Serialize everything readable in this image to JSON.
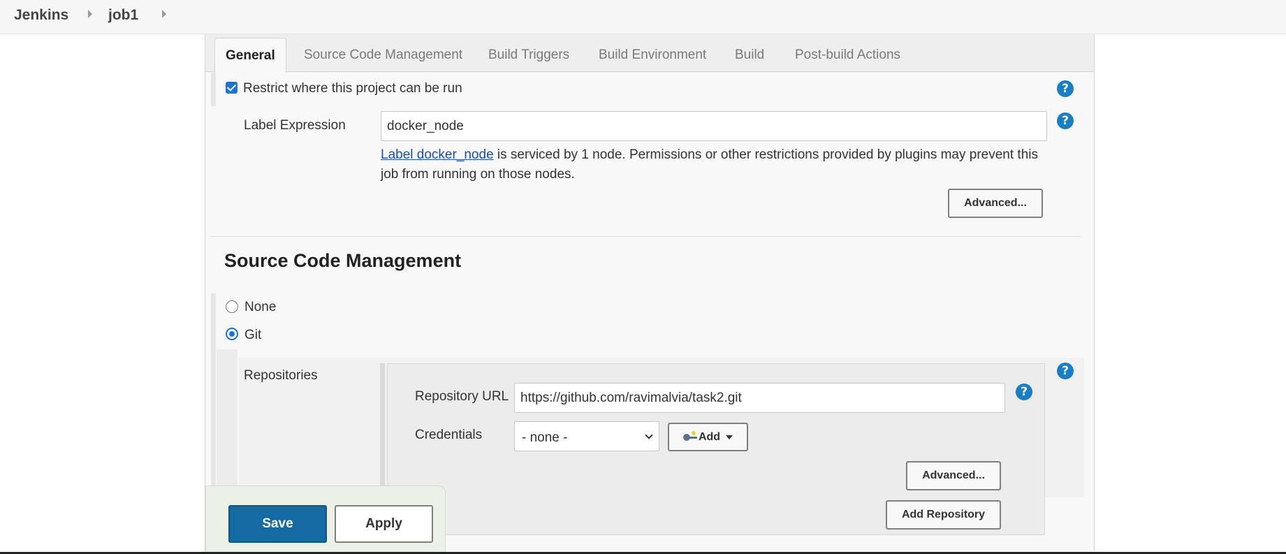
{
  "breadcrumb": {
    "items": [
      "Jenkins",
      "job1"
    ]
  },
  "tabs": [
    {
      "label": "General",
      "active": true
    },
    {
      "label": "Source Code Management",
      "active": false
    },
    {
      "label": "Build Triggers",
      "active": false
    },
    {
      "label": "Build Environment",
      "active": false
    },
    {
      "label": "Build",
      "active": false
    },
    {
      "label": "Post-build Actions",
      "active": false
    }
  ],
  "general": {
    "restrict_checkbox_label": "Restrict where this project can be run",
    "restrict_checked": true,
    "label_expression_label": "Label Expression",
    "label_expression_value": "docker_node",
    "info_link": "Label docker_node",
    "info_text_1": " is serviced by 1 node. Permissions or other restrictions provided by plugins may prevent this",
    "info_text_2": "job from running on those nodes.",
    "advanced_label": "Advanced..."
  },
  "scm": {
    "title": "Source Code Management",
    "options": [
      {
        "label": "None",
        "selected": false
      },
      {
        "label": "Git",
        "selected": true
      }
    ],
    "repositories_label": "Repositories",
    "repo_url_label": "Repository URL",
    "repo_url_value": "https://github.com/ravimalvia/task2.git",
    "credentials_label": "Credentials",
    "credentials_selected": "- none -",
    "add_label": "Add",
    "advanced_label": "Advanced...",
    "add_repository_label": "Add Repository"
  },
  "footer": {
    "save_label": "Save",
    "apply_label": "Apply"
  },
  "help_symbol": "?",
  "icons": {
    "help": "help-icon",
    "credentials_key": "key-icon",
    "breadcrumb_separator": "chevron-right-icon"
  },
  "colors": {
    "primary_button": "#136ba2",
    "help_icon": "#1a7ec2",
    "link": "#1d4fa6",
    "checkbox": "#1a73d6"
  }
}
